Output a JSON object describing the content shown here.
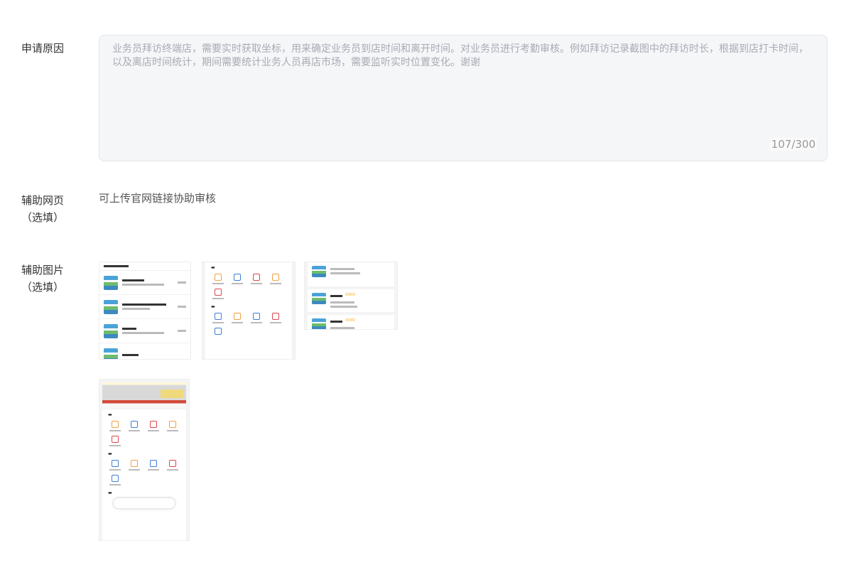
{
  "form": {
    "reason": {
      "label": "申请原因",
      "text": "业务员拜访终端店，需要实时获取坐标，用来确定业务员到店时间和离开时间。对业务员进行考勤审核。例如拜访记录截图中的拜访时长，根据到店打卡时间，以及离店时间统计，期间需要统计业务人员再店市场，需要监听实时位置变化。谢谢",
      "count": "107/300"
    },
    "webpage": {
      "label": "辅助网页",
      "optional": "（选填）",
      "hint": "可上传官网链接协助审核"
    },
    "images": {
      "label": "辅助图片",
      "optional": "（选填）",
      "thumbnails": [
        {
          "name": "screenshot-store-list"
        },
        {
          "name": "screenshot-visit-menu"
        },
        {
          "name": "screenshot-visit-records"
        },
        {
          "name": "screenshot-home"
        }
      ]
    }
  },
  "colors": {
    "textarea_bg": "#f5f6f8",
    "placeholder_text": "#a8abb3",
    "label_text": "#333333"
  }
}
